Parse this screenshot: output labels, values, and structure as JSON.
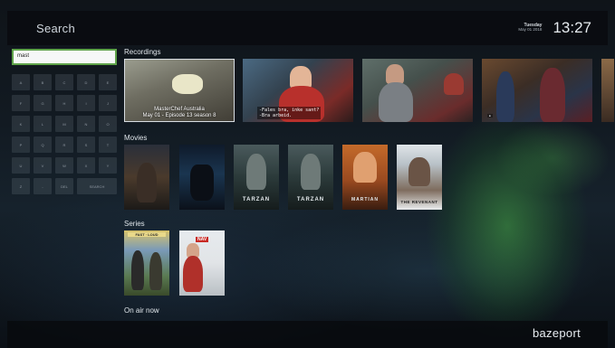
{
  "header": {
    "title": "Search",
    "day": "Tuesday",
    "date": "May 01 2018",
    "time": "13:27"
  },
  "search": {
    "value": "mast"
  },
  "keyboard": {
    "keys": [
      "A",
      "B",
      "C",
      "D",
      "E",
      "F",
      "G",
      "H",
      "I",
      "J",
      "K",
      "L",
      "M",
      "N",
      "O",
      "P",
      "Q",
      "R",
      "S",
      "T",
      "U",
      "V",
      "W",
      "X",
      "Y",
      "Z",
      "-",
      "DEL",
      "SEARCH"
    ]
  },
  "sections": {
    "recordings": "Recordings",
    "movies": "Movies",
    "series": "Series",
    "on_air": "On air now"
  },
  "recordings": {
    "item1": {
      "title": "MasterChef Australia",
      "subtitle": "May 01 - Episode 13 season 8"
    },
    "item2": {
      "subtitle_line1": "-Fales bra, inke sant?",
      "subtitle_line2": "-Bra arbeid."
    }
  },
  "movies": {
    "tarzan_1": "TARZAN",
    "tarzan_2": "TARZAN",
    "martian": "MARTIAN",
    "revenant": "THE REVENANT"
  },
  "series": {
    "item1_title": "FAST · LOUD",
    "item2_title": "NAV"
  },
  "footer": {
    "brand": "bazeport"
  }
}
